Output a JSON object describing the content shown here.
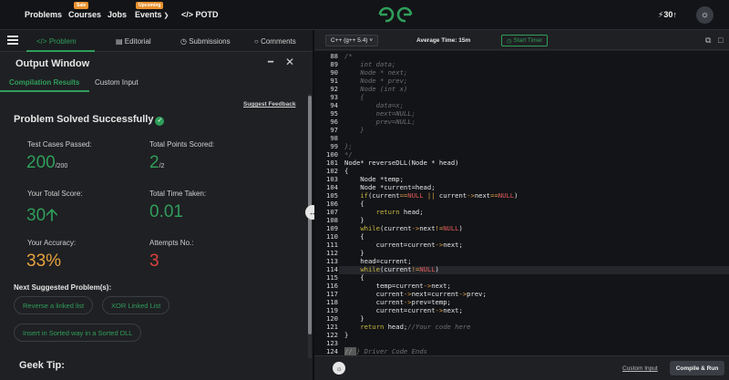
{
  "nav": {
    "problems": "Problems",
    "courses": "Courses",
    "courses_badge": "Sale",
    "jobs": "Jobs",
    "events": "Events",
    "events_badge": "Upcoming",
    "potd": "POTD",
    "streak": "30"
  },
  "tabs": {
    "problem": "Problem",
    "editorial": "Editorial",
    "submissions": "Submissions",
    "comments": "Comments"
  },
  "output": {
    "title": "Output Window",
    "tab_compilation": "Compilation Results",
    "tab_custom": "Custom Input",
    "suggest_feedback": "Suggest Feedback",
    "solved_text": "Problem Solved Successfully",
    "test_cases_label": "Test Cases Passed:",
    "test_cases_value": "200",
    "test_cases_total": "/200",
    "points_label": "Total Points Scored:",
    "points_value": "2",
    "points_total": "/2",
    "score_label": "Your Total Score:",
    "score_value": "30",
    "time_label": "Total Time Taken:",
    "time_value": "0.01",
    "accuracy_label": "Your Accuracy:",
    "accuracy_value": "33%",
    "attempts_label": "Attempts No.:",
    "attempts_value": "3",
    "next_title": "Next Suggested Problem(s):",
    "suggestions": [
      "Reverse a linked list",
      "XOR Linked List",
      "Insert in Sorted way in a Sorted DLL"
    ],
    "geek_tip": "Geek Tip:"
  },
  "editor": {
    "language": "C++ (g++ 5.4)",
    "avg_time": "Average Time: 15m",
    "start_timer": "Start Timer",
    "custom_input": "Custom Input",
    "compile_run": "Compile & Run"
  },
  "code_lines": [
    {
      "n": "88",
      "t": "/*"
    },
    {
      "n": "89",
      "t": "    int data;"
    },
    {
      "n": "90",
      "t": "    Node * next;"
    },
    {
      "n": "91",
      "t": "    Node * prev;"
    },
    {
      "n": "92",
      "t": "    Node (int x)"
    },
    {
      "n": "93",
      "t": "    {"
    },
    {
      "n": "94",
      "t": "        data=x;"
    },
    {
      "n": "95",
      "t": "        next=NULL;"
    },
    {
      "n": "96",
      "t": "        prev=NULL;"
    },
    {
      "n": "97",
      "t": "    }"
    },
    {
      "n": "98",
      "t": ""
    },
    {
      "n": "99",
      "t": "};"
    },
    {
      "n": "100",
      "t": "*/"
    },
    {
      "n": "101",
      "t": "Node* reverseDLL(Node * head)"
    },
    {
      "n": "102",
      "t": "{"
    },
    {
      "n": "103",
      "t": "    Node *temp;"
    },
    {
      "n": "104",
      "t": "    Node *current=head;"
    },
    {
      "n": "105",
      "t": "    if(current==NULL || current->next==NULL)"
    },
    {
      "n": "106",
      "t": "    {"
    },
    {
      "n": "107",
      "t": "        return head;"
    },
    {
      "n": "108",
      "t": "    }"
    },
    {
      "n": "109",
      "t": "    while(current->next!=NULL)"
    },
    {
      "n": "110",
      "t": "    {"
    },
    {
      "n": "111",
      "t": "        current=current->next;"
    },
    {
      "n": "112",
      "t": "    }"
    },
    {
      "n": "113",
      "t": "    head=current;"
    },
    {
      "n": "114",
      "t": "    while(current!=NULL)"
    },
    {
      "n": "115",
      "t": "    {"
    },
    {
      "n": "116",
      "t": "        temp=current->next;"
    },
    {
      "n": "117",
      "t": "        current->next=current->prev;"
    },
    {
      "n": "118",
      "t": "        current->prev=temp;"
    },
    {
      "n": "119",
      "t": "        current=current->next;"
    },
    {
      "n": "120",
      "t": "    }"
    },
    {
      "n": "121",
      "t": "    return head;//Your code here"
    },
    {
      "n": "122",
      "t": "}"
    },
    {
      "n": "123",
      "t": ""
    },
    {
      "n": "124",
      "t": "// } Driver Code Ends"
    }
  ]
}
